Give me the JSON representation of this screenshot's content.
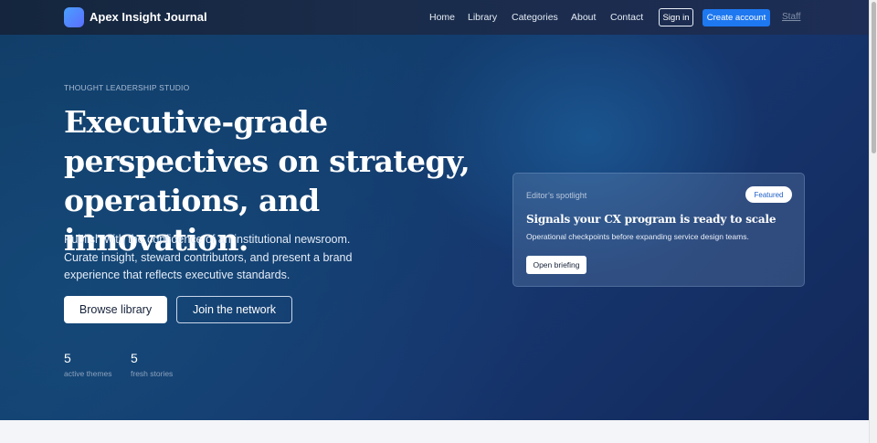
{
  "header": {
    "brand": "Apex Insight Journal",
    "nav": [
      {
        "label": "Home"
      },
      {
        "label": "Library"
      },
      {
        "label": "Categories"
      },
      {
        "label": "About"
      },
      {
        "label": "Contact"
      }
    ],
    "signin_label": "Sign in",
    "create_label": "Create account",
    "staff_label": "Staff"
  },
  "hero": {
    "eyebrow": "THOUGHT LEADERSHIP STUDIO",
    "headline": "Executive-grade perspectives on strategy, operations, and innovation.",
    "lede": "Publish with the confidence of an institutional newsroom. Curate insight, steward contributors, and present a brand experience that reflects executive standards.",
    "primary_cta": "Browse library",
    "secondary_cta": "Join the network",
    "stats": [
      {
        "value": "5",
        "label": "active themes"
      },
      {
        "value": "5",
        "label": "fresh stories"
      }
    ]
  },
  "spotlight": {
    "kicker": "Editor’s spotlight",
    "badge": "Featured",
    "title": "Signals your CX program is ready to scale",
    "subtitle": "Operational checkpoints before expanding service design teams.",
    "button": "Open briefing"
  },
  "colors": {
    "accent": "#1e78f0",
    "hero_dark": "#13285a",
    "hero_light": "#0f3a63"
  },
  "icons": {
    "logo": "gradient-square-logo-icon"
  }
}
